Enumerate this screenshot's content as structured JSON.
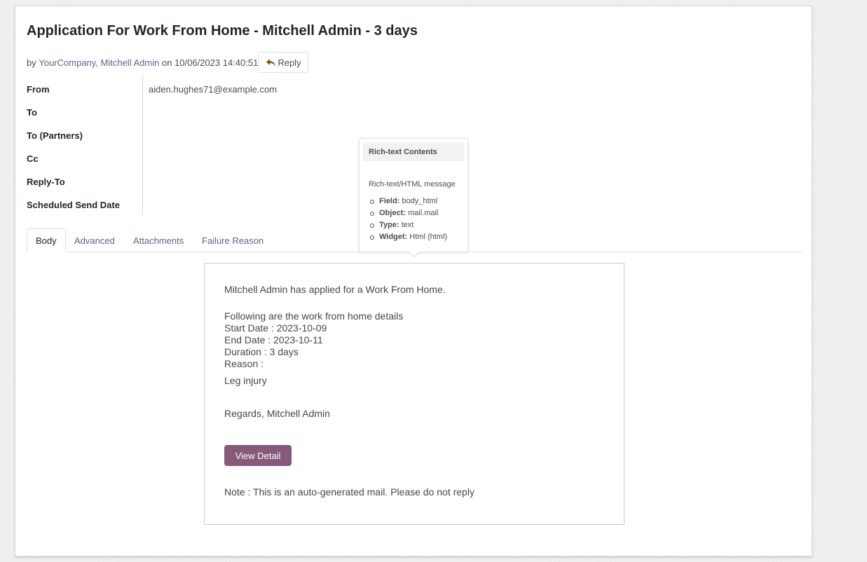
{
  "header": {
    "title": "Application For Work From Home - Mitchell Admin - 3 days",
    "by": "by",
    "authors": "YourCompany, Mitchell Admin",
    "on_date": "on 10/06/2023 14:40:51",
    "reply_label": "Reply"
  },
  "fields": {
    "from_label": "From",
    "from_value": "aiden.hughes71@example.com",
    "to_label": "To",
    "to_partners_label": "To (Partners)",
    "cc_label": "Cc",
    "reply_to_label": "Reply-To",
    "scheduled_label": "Scheduled Send Date"
  },
  "tabs": [
    {
      "label": "Body",
      "active": true
    },
    {
      "label": "Advanced",
      "active": false
    },
    {
      "label": "Attachments",
      "active": false
    },
    {
      "label": "Failure Reason",
      "active": false
    }
  ],
  "tooltip": {
    "title": "Rich-text Contents",
    "description": "Rich-text/HTML message",
    "items": [
      {
        "key": "Field:",
        "value": "body_html"
      },
      {
        "key": "Object:",
        "value": "mail.mail"
      },
      {
        "key": "Type:",
        "value": "text"
      },
      {
        "key": "Widget:",
        "value": "Html (html)"
      }
    ]
  },
  "body": {
    "intro": "Mitchell Admin has applied for a Work From Home.",
    "details_heading": "Following are the work from home details",
    "start_date": "Start Date : 2023-10-09",
    "end_date": "End Date : 2023-10-11",
    "duration": "Duration : 3 days",
    "reason_label": "Reason :",
    "reason": "Leg injury",
    "regards": "Regards, Mitchell Admin",
    "button_label": "View Detail",
    "note": "Note : This is an auto-generated mail. Please do not reply"
  },
  "colors": {
    "link": "#6e5a86",
    "button": "#875a7b",
    "reply_icon": "#7a5a0c"
  }
}
